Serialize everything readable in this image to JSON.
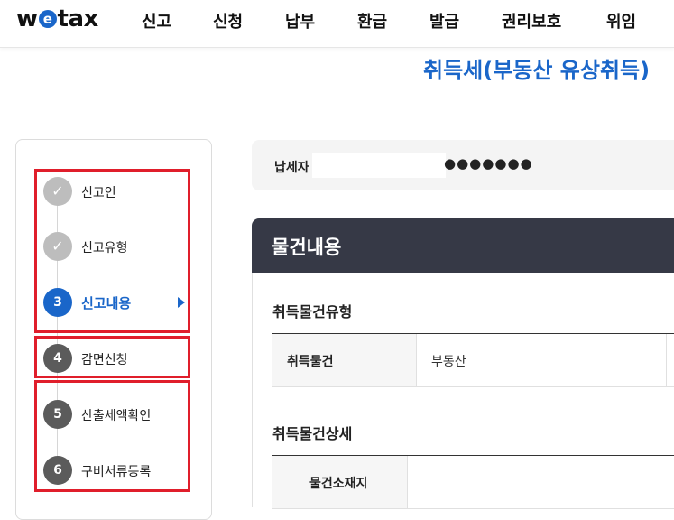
{
  "header": {
    "logo_prefix": "w",
    "logo_e": "e",
    "logo_suffix": "tax",
    "nav": [
      "신고",
      "신청",
      "납부",
      "환급",
      "발급",
      "권리보호",
      "위임"
    ]
  },
  "page_title": "취득세(부동산 유상취득)",
  "steps": [
    {
      "number": "✓",
      "label": "신고인",
      "state": "done"
    },
    {
      "number": "✓",
      "label": "신고유형",
      "state": "done"
    },
    {
      "number": "3",
      "label": "신고내용",
      "state": "active"
    },
    {
      "number": "4",
      "label": "감면신청",
      "state": "todo"
    },
    {
      "number": "5",
      "label": "산출세액확인",
      "state": "todo"
    },
    {
      "number": "6",
      "label": "구비서류등록",
      "state": "todo"
    }
  ],
  "taxpayer": {
    "label": "납세자",
    "value": "●●●●●●●"
  },
  "section": {
    "title": "물건내용",
    "acquisition_type": {
      "title": "취득물건유형",
      "row_header": "취득물건",
      "row_value": "부동산"
    },
    "acquisition_detail": {
      "title": "취득물건상세",
      "row_header": "물건소재지"
    }
  },
  "colors": {
    "accent": "#1a66c9",
    "highlight": "#e01e2b",
    "section_header": "#363946"
  }
}
